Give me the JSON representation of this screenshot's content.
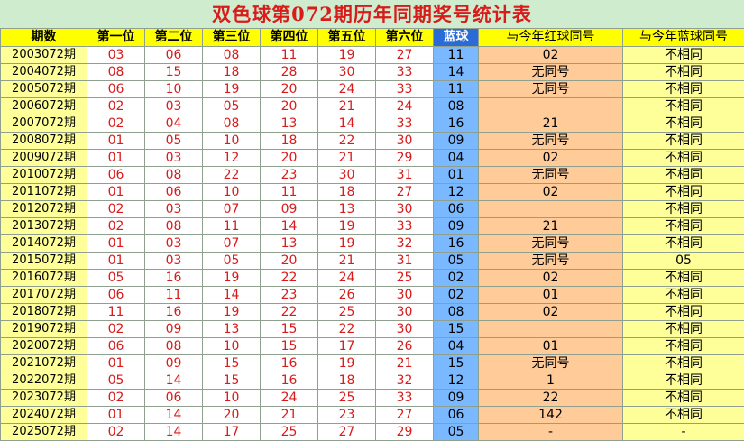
{
  "title": "双色球第072期历年同期奖号统计表",
  "headers": [
    "期数",
    "第一位",
    "第二位",
    "第三位",
    "第四位",
    "第五位",
    "第六位",
    "蓝球",
    "与今年红球同号",
    "与今年蓝球同号"
  ],
  "rows": [
    {
      "period": "2003072期",
      "reds": [
        "03",
        "06",
        "08",
        "11",
        "19",
        "27"
      ],
      "blue": "11",
      "red_match": "02",
      "blue_match": "不相同"
    },
    {
      "period": "2004072期",
      "reds": [
        "08",
        "15",
        "18",
        "28",
        "30",
        "33"
      ],
      "blue": "14",
      "red_match": "无同号",
      "blue_match": "不相同"
    },
    {
      "period": "2005072期",
      "reds": [
        "06",
        "10",
        "19",
        "20",
        "24",
        "33"
      ],
      "blue": "11",
      "red_match": "无同号",
      "blue_match": "不相同"
    },
    {
      "period": "2006072期",
      "reds": [
        "02",
        "03",
        "05",
        "20",
        "21",
        "24"
      ],
      "blue": "08",
      "red_match": "",
      "blue_match": "不相同"
    },
    {
      "period": "2007072期",
      "reds": [
        "02",
        "04",
        "08",
        "13",
        "14",
        "33"
      ],
      "blue": "16",
      "red_match": "21",
      "blue_match": "不相同"
    },
    {
      "period": "2008072期",
      "reds": [
        "01",
        "05",
        "10",
        "18",
        "22",
        "30"
      ],
      "blue": "09",
      "red_match": "无同号",
      "blue_match": "不相同"
    },
    {
      "period": "2009072期",
      "reds": [
        "01",
        "03",
        "12",
        "20",
        "21",
        "29"
      ],
      "blue": "04",
      "red_match": "02",
      "blue_match": "不相同"
    },
    {
      "period": "2010072期",
      "reds": [
        "06",
        "08",
        "22",
        "23",
        "30",
        "31"
      ],
      "blue": "01",
      "red_match": "无同号",
      "blue_match": "不相同"
    },
    {
      "period": "2011072期",
      "reds": [
        "01",
        "06",
        "10",
        "11",
        "18",
        "27"
      ],
      "blue": "12",
      "red_match": "02",
      "blue_match": "不相同"
    },
    {
      "period": "2012072期",
      "reds": [
        "02",
        "03",
        "07",
        "09",
        "13",
        "30"
      ],
      "blue": "06",
      "red_match": "",
      "blue_match": "不相同"
    },
    {
      "period": "2013072期",
      "reds": [
        "02",
        "08",
        "11",
        "14",
        "19",
        "33"
      ],
      "blue": "09",
      "red_match": "21",
      "blue_match": "不相同"
    },
    {
      "period": "2014072期",
      "reds": [
        "01",
        "03",
        "07",
        "13",
        "19",
        "32"
      ],
      "blue": "16",
      "red_match": "无同号",
      "blue_match": "不相同"
    },
    {
      "period": "2015072期",
      "reds": [
        "01",
        "03",
        "05",
        "20",
        "21",
        "31"
      ],
      "blue": "05",
      "red_match": "无同号",
      "blue_match": "05"
    },
    {
      "period": "2016072期",
      "reds": [
        "05",
        "16",
        "19",
        "22",
        "24",
        "25"
      ],
      "blue": "02",
      "red_match": "02",
      "blue_match": "不相同"
    },
    {
      "period": "2017072期",
      "reds": [
        "06",
        "11",
        "14",
        "23",
        "26",
        "30"
      ],
      "blue": "02",
      "red_match": "01",
      "blue_match": "不相同"
    },
    {
      "period": "2018072期",
      "reds": [
        "11",
        "16",
        "19",
        "22",
        "25",
        "30"
      ],
      "blue": "08",
      "red_match": "02",
      "blue_match": "不相同"
    },
    {
      "period": "2019072期",
      "reds": [
        "02",
        "09",
        "13",
        "15",
        "22",
        "30"
      ],
      "blue": "15",
      "red_match": "",
      "blue_match": "不相同"
    },
    {
      "period": "2020072期",
      "reds": [
        "06",
        "08",
        "10",
        "15",
        "17",
        "26"
      ],
      "blue": "04",
      "red_match": "01",
      "blue_match": "不相同"
    },
    {
      "period": "2021072期",
      "reds": [
        "01",
        "09",
        "15",
        "16",
        "19",
        "21"
      ],
      "blue": "15",
      "red_match": "无同号",
      "blue_match": "不相同"
    },
    {
      "period": "2022072期",
      "reds": [
        "05",
        "14",
        "15",
        "16",
        "18",
        "32"
      ],
      "blue": "12",
      "red_match": "1",
      "blue_match": "不相同"
    },
    {
      "period": "2023072期",
      "reds": [
        "02",
        "06",
        "10",
        "24",
        "25",
        "33"
      ],
      "blue": "09",
      "red_match": "22",
      "blue_match": "不相同"
    },
    {
      "period": "2024072期",
      "reds": [
        "01",
        "14",
        "20",
        "21",
        "23",
        "27"
      ],
      "blue": "06",
      "red_match": "142",
      "blue_match": "不相同"
    },
    {
      "period": "2025072期",
      "reds": [
        "02",
        "14",
        "17",
        "25",
        "27",
        "29"
      ],
      "blue": "05",
      "red_match": "-",
      "blue_match": "-"
    }
  ],
  "colors": {
    "title": "#d81b1b",
    "header_bg": "#ffff00",
    "blue_header_bg": "#2a6bd6",
    "period_bg": "#ffff99",
    "red_number": "#d81b1b",
    "blue_cell_bg": "#7ab8ff",
    "red_match_bg": "#ffcc99",
    "blue_match_bg": "#ffff99"
  }
}
